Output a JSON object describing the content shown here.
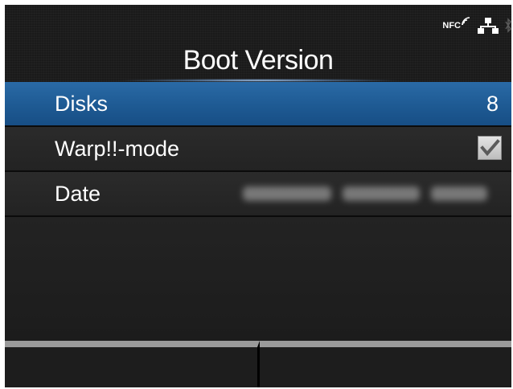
{
  "status_bar": {
    "nfc_label": "NFC",
    "icons": [
      "nfc-icon",
      "lan-icon",
      "bluetooth-icon"
    ]
  },
  "header": {
    "title": "Boot Version"
  },
  "settings": [
    {
      "label": "Disks",
      "value": "8",
      "selected": true
    },
    {
      "label": "Warp!!-mode",
      "value_type": "checkbox",
      "checked": true
    },
    {
      "label": "Date",
      "value_obscured": true
    }
  ],
  "softkeys": {
    "left_label": "",
    "right_label": ""
  },
  "colors": {
    "selection": "#1e5a93",
    "background": "#1a1a1a",
    "softkey_bar": "#9a9a9a"
  }
}
